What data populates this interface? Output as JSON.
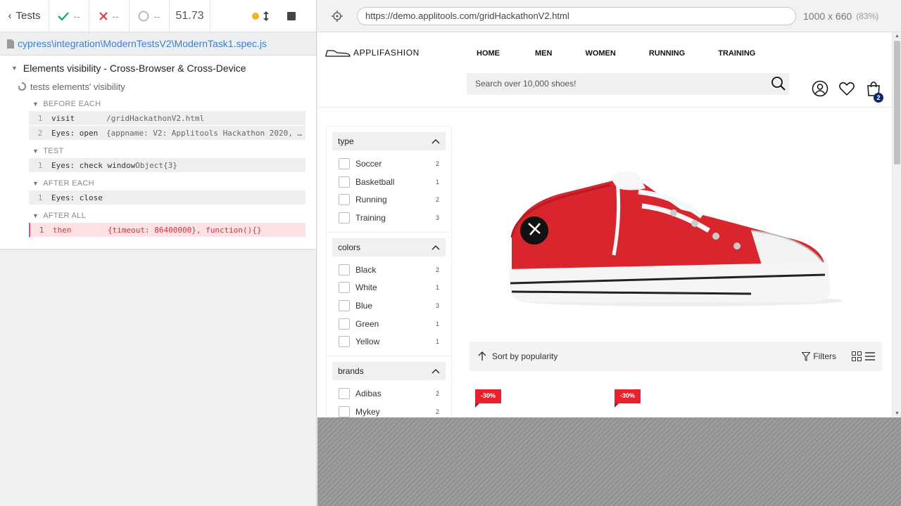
{
  "runner": {
    "back_label": "Tests",
    "passed": "--",
    "failed": "--",
    "pending": "--",
    "duration": "51.73",
    "spec_path": "cypress\\integration\\ModernTestsV2\\ModernTask1.spec.js",
    "suite_title": "Elements visibility - Cross-Browser & Cross-Device",
    "test_title": "tests elements' visibility",
    "hooks": [
      {
        "title": "BEFORE EACH",
        "commands": [
          {
            "num": "1",
            "name": "visit",
            "message": "/gridHackathonV2.html"
          },
          {
            "num": "2",
            "name": "Eyes: open",
            "message": "{appname: V2: Applitools Hackathon 2020, …"
          }
        ]
      },
      {
        "title": "TEST",
        "commands": [
          {
            "num": "1",
            "name": "Eyes: check window",
            "message": "Object{3}"
          }
        ]
      },
      {
        "title": "AFTER EACH",
        "commands": [
          {
            "num": "1",
            "name": "Eyes: close",
            "message": ""
          }
        ]
      },
      {
        "title": "AFTER ALL",
        "commands": [
          {
            "num": "1",
            "name": "then",
            "message": "{timeout: 86400000}, function(){}"
          }
        ]
      }
    ]
  },
  "aut": {
    "url": "https://demo.applitools.com/gridHackathonV2.html",
    "viewport": "1000 x 660",
    "scale": "(83%)"
  },
  "site": {
    "brand": "APPLIFASHION",
    "nav": [
      "HOME",
      "MEN",
      "WOMEN",
      "RUNNING",
      "TRAINING"
    ],
    "search_placeholder": "Search over 10,000 shoes!",
    "cart_count": "2",
    "filters": [
      {
        "title": "type",
        "items": [
          {
            "label": "Soccer",
            "count": "2"
          },
          {
            "label": "Basketball",
            "count": "1"
          },
          {
            "label": "Running",
            "count": "2"
          },
          {
            "label": "Training",
            "count": "3"
          }
        ]
      },
      {
        "title": "colors",
        "items": [
          {
            "label": "Black",
            "count": "2"
          },
          {
            "label": "White",
            "count": "1"
          },
          {
            "label": "Blue",
            "count": "3"
          },
          {
            "label": "Green",
            "count": "1"
          },
          {
            "label": "Yellow",
            "count": "1"
          }
        ]
      },
      {
        "title": "brands",
        "items": [
          {
            "label": "Adibas",
            "count": "2"
          },
          {
            "label": "Mykey",
            "count": "2"
          }
        ]
      }
    ],
    "sort_label": "Sort by popularity",
    "filters_label": "Filters",
    "discount_badges": [
      "-30%",
      "-30%"
    ]
  },
  "colors": {
    "pass": "#1fa971",
    "fail": "#e0393e",
    "link": "#3c7ecf",
    "accent_red": "#e8212e",
    "badge_navy": "#0b2a69"
  }
}
